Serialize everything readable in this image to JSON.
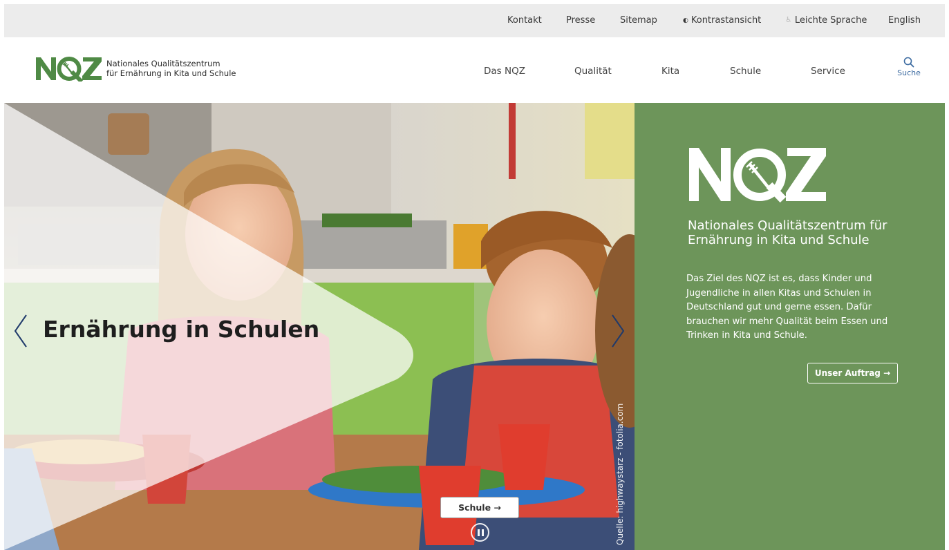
{
  "util_nav": {
    "kontakt": "Kontakt",
    "presse": "Presse",
    "sitemap": "Sitemap",
    "kontrast": "Kontrastansicht",
    "leichte_sprache": "Leichte Sprache",
    "english": "English"
  },
  "logo": {
    "mark": "NQZ",
    "line1": "Nationales Qualitätszentrum",
    "line2": "für Ernährung in Kita und Schule"
  },
  "main_nav": {
    "items": [
      "Das NQZ",
      "Qualität",
      "Kita",
      "Schule",
      "Service"
    ],
    "search_label": "Suche"
  },
  "hero": {
    "title": "Ernährung in Schulen",
    "button_label": "Schule →",
    "credit": "Quelle: highwaystarz - fotolia.com"
  },
  "panel": {
    "logo": "NQZ",
    "title": "Nationales Qualitätszentrum für Ernährung in Kita und Schule",
    "text": "Das Ziel des NQZ ist es, dass Kinder und Jugendliche in allen Kitas und Schulen in Deutschland gut und gerne essen. Dafür brauchen wir mehr Qualität beim Essen und Trinken in Kita und Schule.",
    "button_label": "Unser Auftrag →"
  },
  "colors": {
    "brand_green": "#6d955a",
    "logo_green": "#4f8a45",
    "link_blue": "#3b6aa0",
    "util_bg": "#ececec"
  },
  "icons": [
    "contrast-icon",
    "accessibility-icon",
    "search-icon",
    "chevron-left-icon",
    "chevron-right-icon",
    "pause-icon",
    "arrow-right-icon"
  ]
}
